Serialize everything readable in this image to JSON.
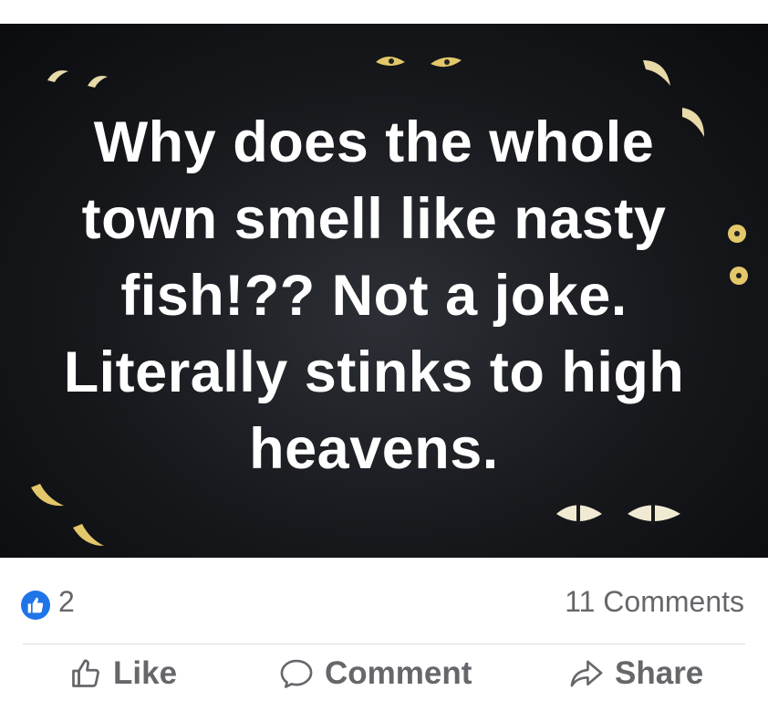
{
  "post": {
    "image_text": "Why does the whole town smell like nasty fish!?? Not a joke. Literally stinks to high heavens.",
    "image_icon": "glowing-eyes-in-dark"
  },
  "reactions": {
    "like_count": "2",
    "comments_count": "11 Comments"
  },
  "actions": {
    "like_label": "Like",
    "comment_label": "Comment",
    "share_label": "Share"
  },
  "colors": {
    "image_background": "#16181c",
    "eye_color": "#e8d9a8",
    "like_blue": "#1f74e8",
    "muted_text": "#65676b",
    "divider": "#dadde1"
  }
}
